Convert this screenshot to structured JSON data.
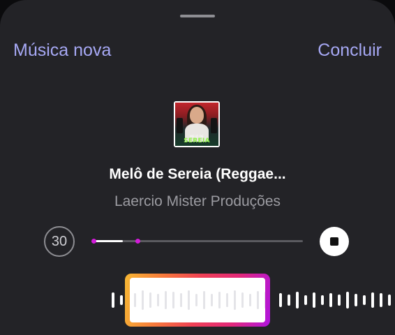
{
  "header": {
    "left_label": "Música nova",
    "right_label": "Concluir"
  },
  "song": {
    "title": "Melô de Sereia (Reggae...",
    "artist": "Laercio Mister Produções",
    "cover_small_text": "MELÔ DE",
    "cover_logo_text": "SEREIA"
  },
  "player": {
    "duration_label": "30",
    "progress_fraction": 0.14,
    "clip_marker_fraction": 0.21
  },
  "colors": {
    "accent": "#a6a8f4",
    "background": "#232327",
    "marker": "#d21bd9"
  },
  "icons": {
    "stop": "stop-icon",
    "handle": "sheet-handle"
  }
}
